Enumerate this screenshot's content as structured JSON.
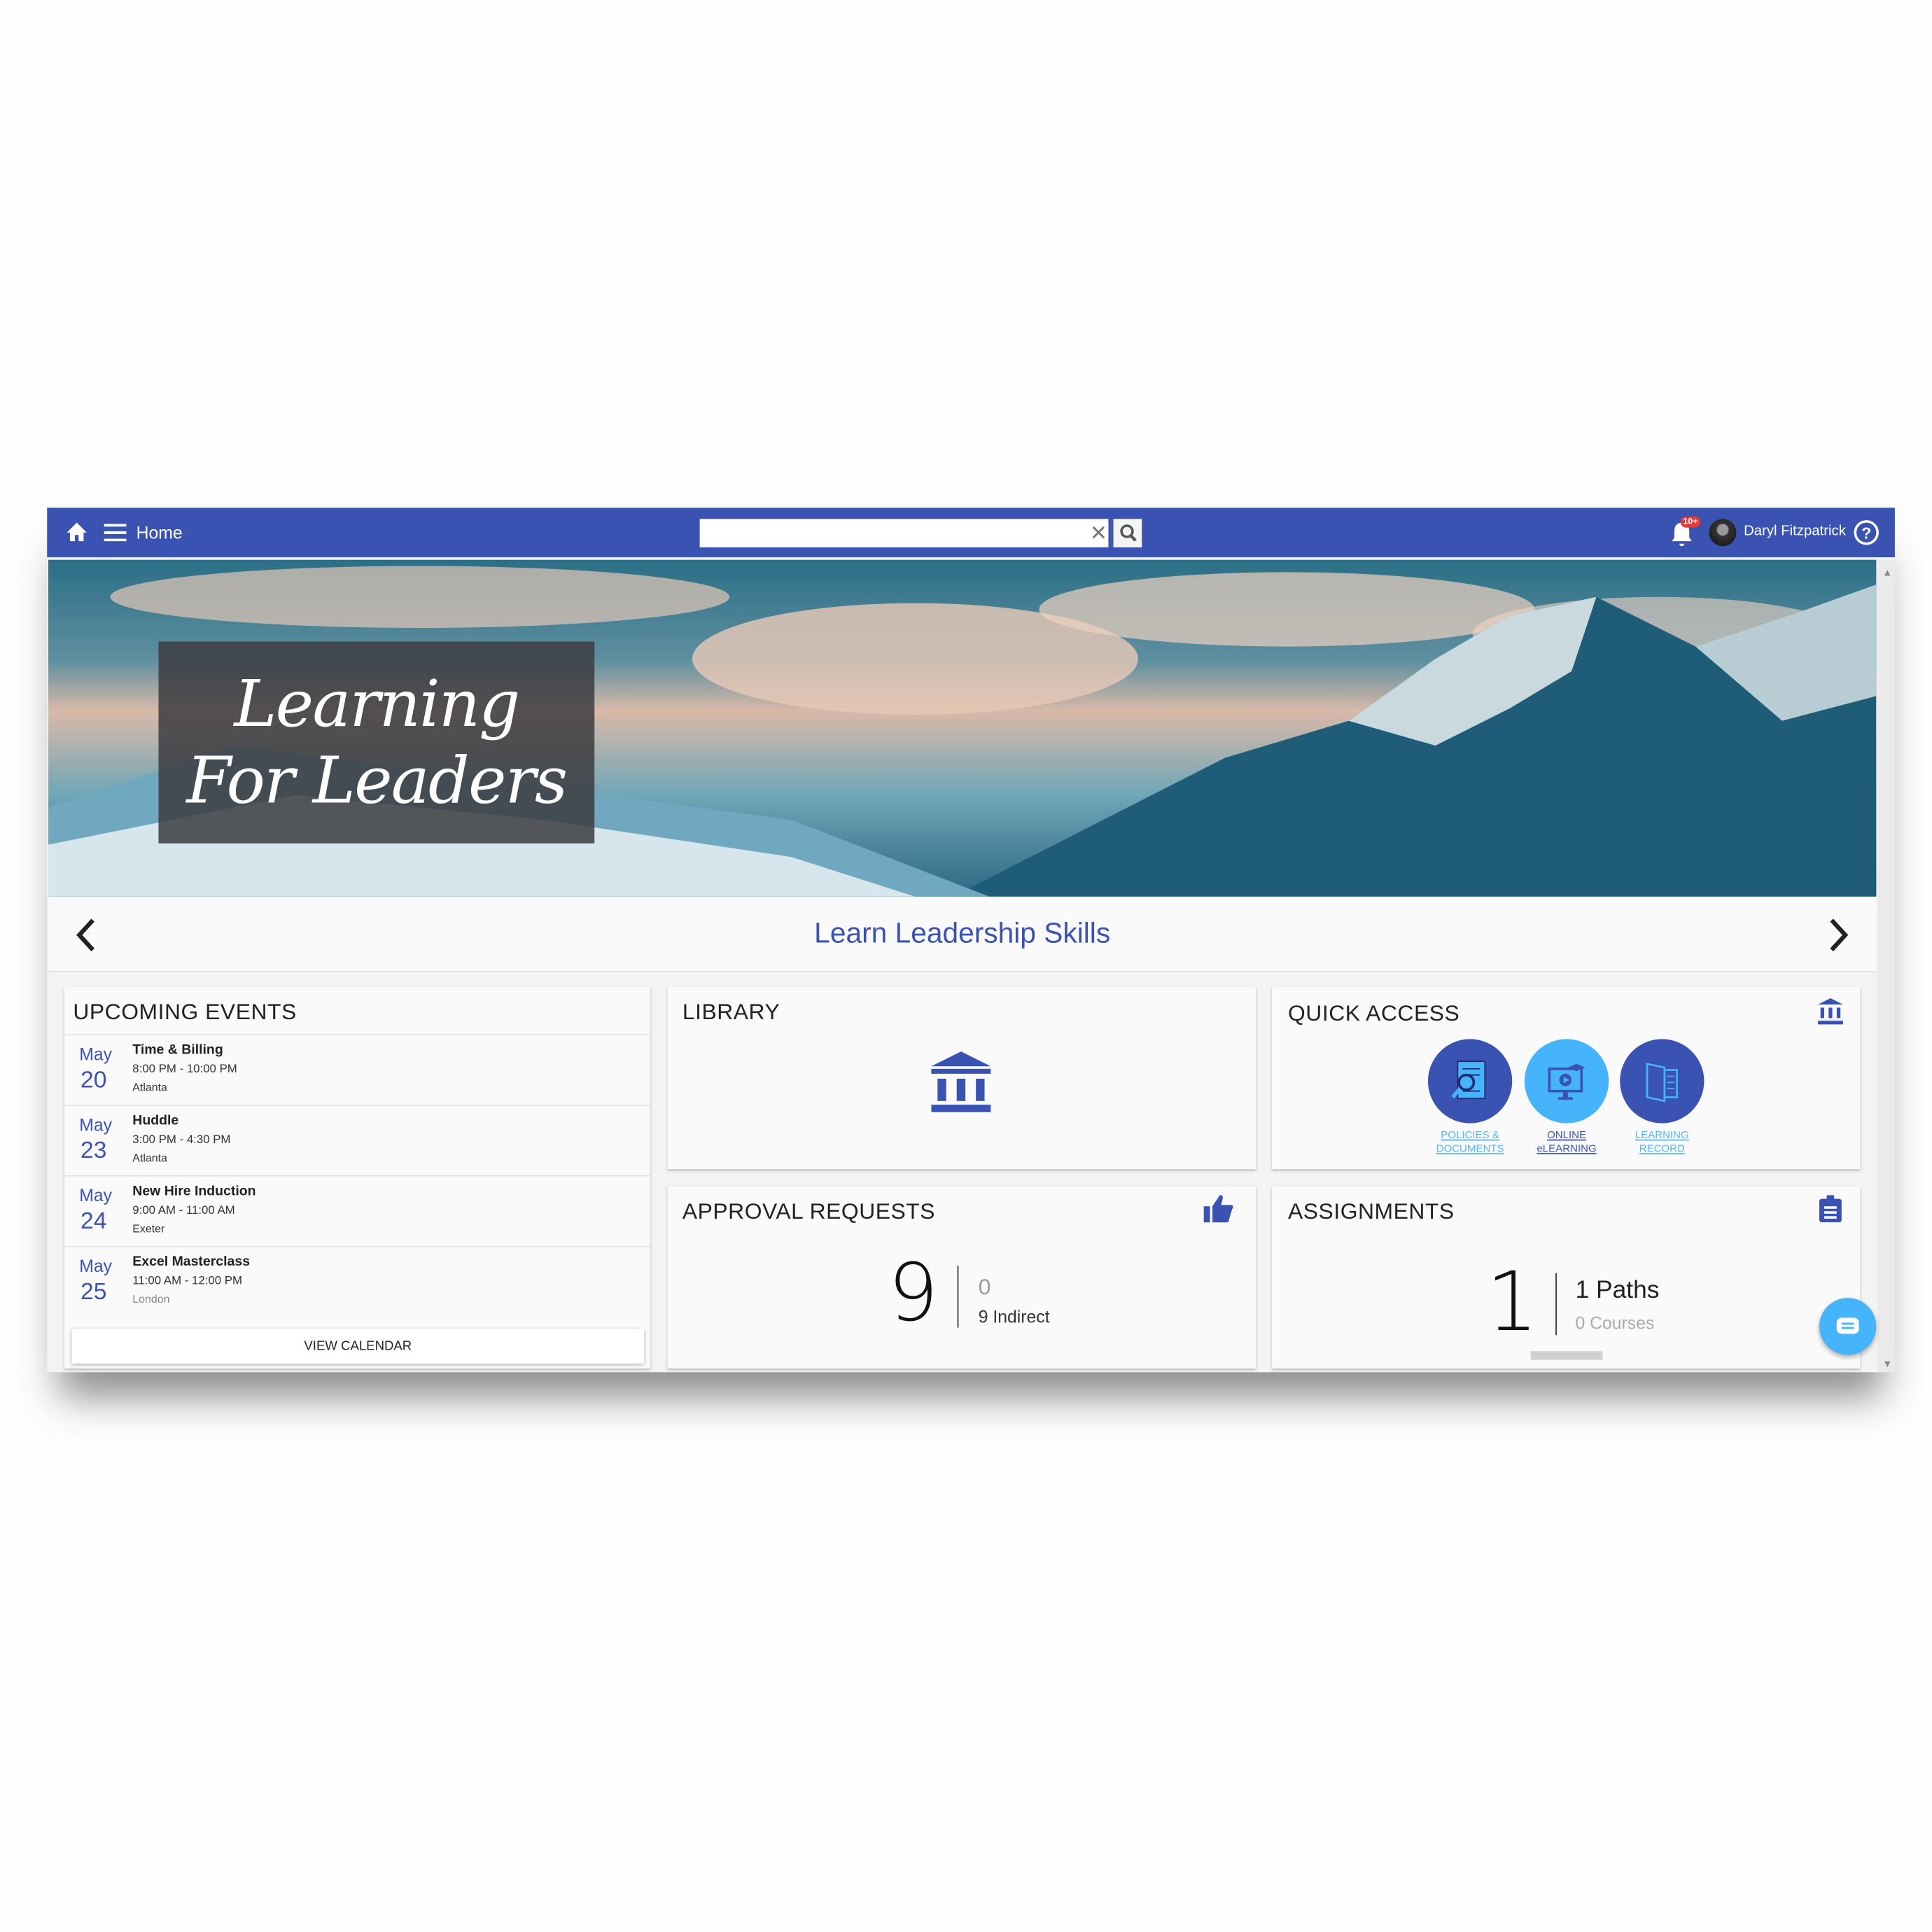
{
  "topbar": {
    "home_label": "Home",
    "search_value": "",
    "user_name": "Daryl Fitzpatrick",
    "notification_badge": "10+",
    "brand_color": "#3a52b2"
  },
  "banner": {
    "title_line1": "Learning",
    "title_line2": "For Leaders",
    "caption": "Learn Leadership Skills"
  },
  "events": {
    "title": "UPCOMING EVENTS",
    "items": [
      {
        "month": "May",
        "day": "20",
        "name": "Time & Billing",
        "time": "8:00 PM - 10:00 PM",
        "location": "Atlanta"
      },
      {
        "month": "May",
        "day": "23",
        "name": "Huddle",
        "time": "3:00 PM - 4:30 PM",
        "location": "Atlanta"
      },
      {
        "month": "May",
        "day": "24",
        "name": "New Hire Induction",
        "time": "9:00 AM - 11:00 AM",
        "location": "Exeter"
      },
      {
        "month": "May",
        "day": "25",
        "name": "Excel Masterclass",
        "time": "11:00 AM - 12:00 PM",
        "location": "London"
      }
    ],
    "view_calendar": "VIEW CALENDAR"
  },
  "library": {
    "title": "LIBRARY",
    "icon": "bank-icon"
  },
  "quick_access": {
    "title": "QUICK ACCESS",
    "items": [
      {
        "line1": "POLICIES &",
        "line2": "DOCUMENTS",
        "color": "#3a52b2"
      },
      {
        "line1": "ONLINE",
        "line2": "eLEARNING",
        "color": "#45b4fb"
      },
      {
        "line1": "LEARNING",
        "line2": "RECORD",
        "color": "#3a52b2"
      }
    ]
  },
  "approvals": {
    "title": "APPROVAL REQUESTS",
    "total": "9",
    "direct": "0",
    "indirect": "9 Indirect"
  },
  "assignments": {
    "title": "ASSIGNMENTS",
    "total": "1",
    "paths": "1 Paths",
    "courses": "0 Courses"
  }
}
